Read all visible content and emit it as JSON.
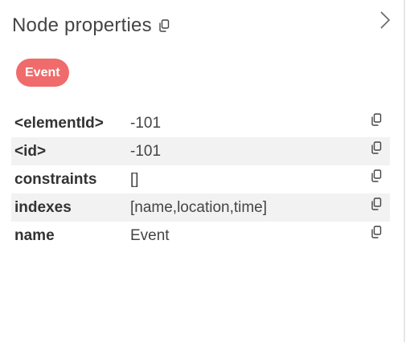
{
  "panel": {
    "title": "Node properties",
    "badge": "Event",
    "badge_color": "#f06b6b"
  },
  "icons": {
    "collapse": "chevron-right-icon",
    "copy": "copy-icon"
  },
  "properties": [
    {
      "key": "<elementId>",
      "value": "-101"
    },
    {
      "key": "<id>",
      "value": "-101"
    },
    {
      "key": "constraints",
      "value": "[]"
    },
    {
      "key": "indexes",
      "value": "[name,location,time]"
    },
    {
      "key": "name",
      "value": "Event"
    }
  ]
}
